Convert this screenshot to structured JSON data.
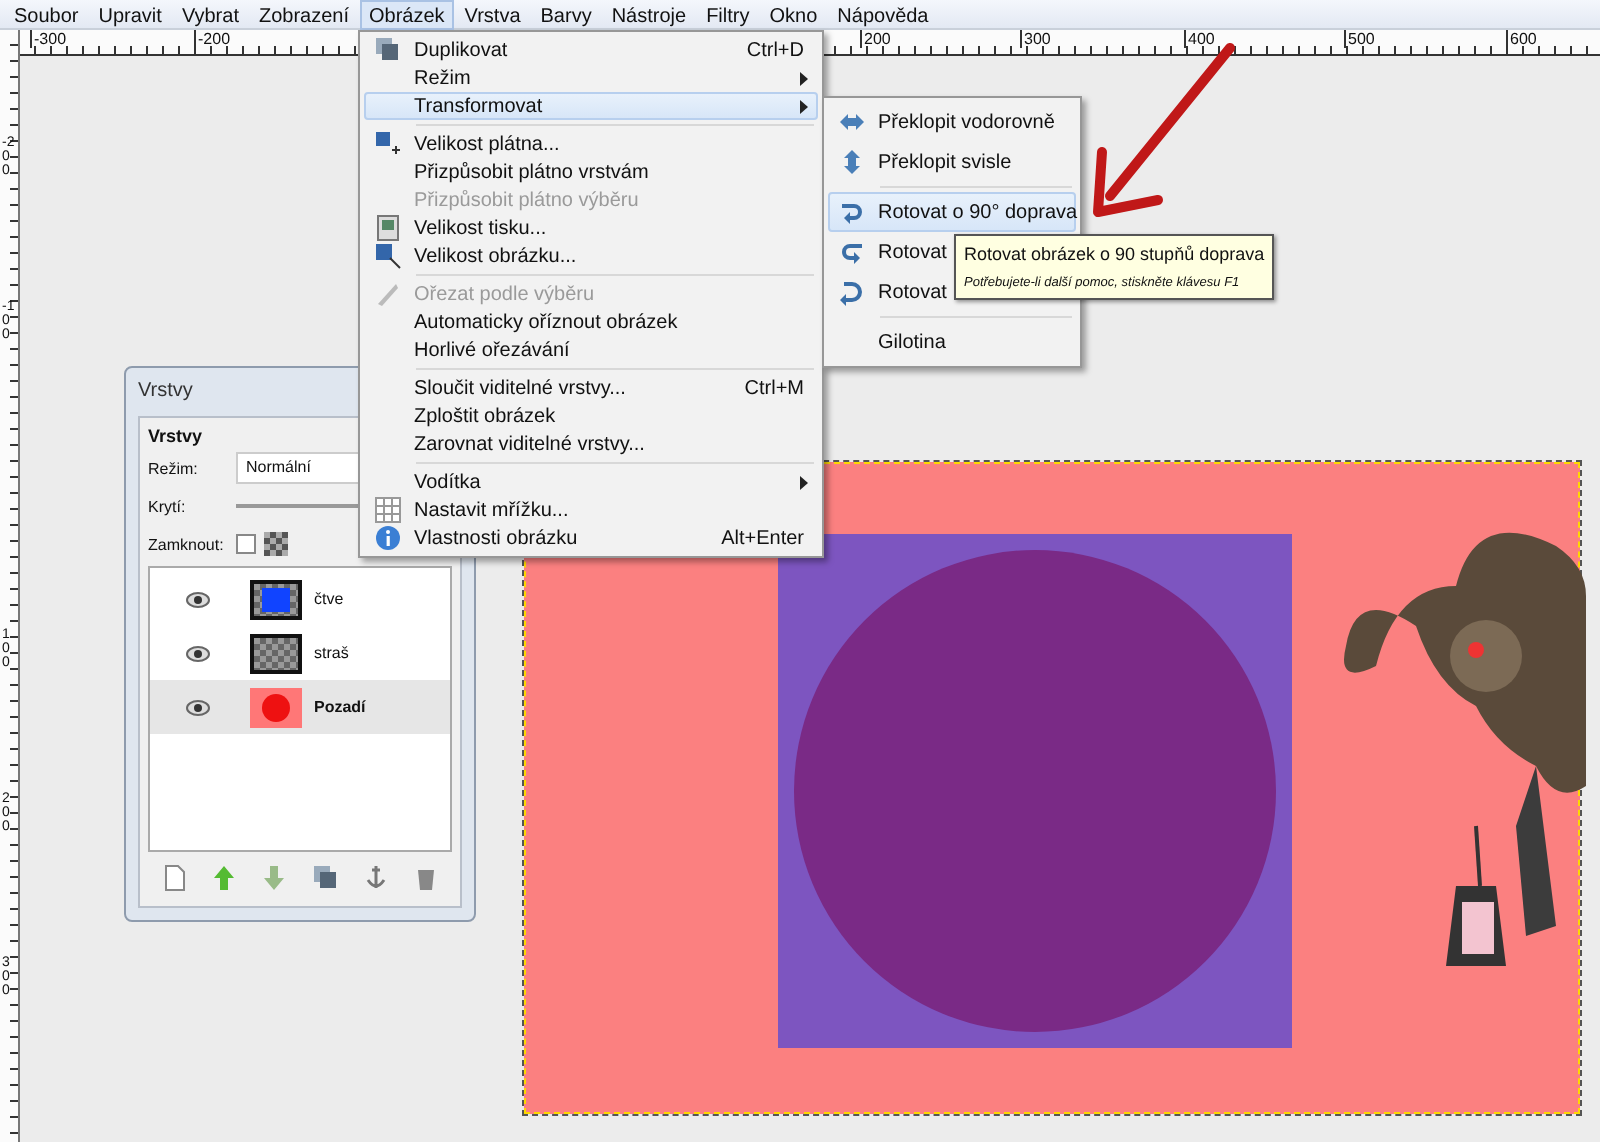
{
  "menubar": [
    {
      "label": "Soubor",
      "selected": false
    },
    {
      "label": "Upravit",
      "selected": false
    },
    {
      "label": "Vybrat",
      "selected": false
    },
    {
      "label": "Zobrazení",
      "selected": false
    },
    {
      "label": "Obrázek",
      "selected": true
    },
    {
      "label": "Vrstva",
      "selected": false
    },
    {
      "label": "Barvy",
      "selected": false
    },
    {
      "label": "Nástroje",
      "selected": false
    },
    {
      "label": "Filtry",
      "selected": false
    },
    {
      "label": "Okno",
      "selected": false
    },
    {
      "label": "Nápověda",
      "selected": false
    }
  ],
  "top_ruler": [
    "-300",
    "-200",
    "200",
    "300",
    "400",
    "500",
    "600"
  ],
  "left_ruler": [
    "-200",
    "-100",
    "100",
    "200",
    "300"
  ],
  "image_menu": [
    {
      "kind": "item",
      "label": "Duplikovat",
      "shortcut": "Ctrl+D",
      "submenu": false,
      "disabled": false,
      "selected": false
    },
    {
      "kind": "item",
      "label": "Režim",
      "submenu": true,
      "disabled": false,
      "selected": false
    },
    {
      "kind": "item",
      "label": "Transformovat",
      "submenu": true,
      "disabled": false,
      "selected": true
    },
    {
      "kind": "separator"
    },
    {
      "kind": "item",
      "label": "Velikost plátna...",
      "submenu": false,
      "disabled": false,
      "selected": false
    },
    {
      "kind": "item",
      "label": "Přizpůsobit plátno vrstvám",
      "submenu": false,
      "disabled": false,
      "selected": false
    },
    {
      "kind": "item",
      "label": "Přizpůsobit plátno výběru",
      "submenu": false,
      "disabled": true,
      "selected": false
    },
    {
      "kind": "item",
      "label": "Velikost tisku...",
      "submenu": false,
      "disabled": false,
      "selected": false
    },
    {
      "kind": "item",
      "label": "Velikost obrázku...",
      "submenu": false,
      "disabled": false,
      "selected": false
    },
    {
      "kind": "separator"
    },
    {
      "kind": "item",
      "label": "Ořezat podle výběru",
      "submenu": false,
      "disabled": true,
      "selected": false
    },
    {
      "kind": "item",
      "label": "Automaticky oříznout obrázek",
      "submenu": false,
      "disabled": false,
      "selected": false
    },
    {
      "kind": "item",
      "label": "Horlivé ořezávání",
      "submenu": false,
      "disabled": false,
      "selected": false
    },
    {
      "kind": "separator"
    },
    {
      "kind": "item",
      "label": "Sloučit viditelné vrstvy...",
      "shortcut": "Ctrl+M",
      "submenu": false,
      "disabled": false,
      "selected": false
    },
    {
      "kind": "item",
      "label": "Zploštit obrázek",
      "submenu": false,
      "disabled": false,
      "selected": false
    },
    {
      "kind": "item",
      "label": "Zarovnat viditelné vrstvy...",
      "submenu": false,
      "disabled": false,
      "selected": false
    },
    {
      "kind": "separator"
    },
    {
      "kind": "item",
      "label": "Vodítka",
      "submenu": true,
      "disabled": false,
      "selected": false
    },
    {
      "kind": "item",
      "label": "Nastavit mřížku...",
      "submenu": false,
      "disabled": false,
      "selected": false
    },
    {
      "kind": "item",
      "label": "Vlastnosti obrázku",
      "shortcut": "Alt+Enter",
      "submenu": false,
      "disabled": false,
      "selected": false
    }
  ],
  "transform_menu": [
    {
      "kind": "item",
      "label": "Překlopit vodorovně",
      "selected": false
    },
    {
      "kind": "item",
      "label": "Překlopit svisle",
      "selected": false
    },
    {
      "kind": "separator"
    },
    {
      "kind": "item",
      "label": "Rotovat o 90° doprava",
      "selected": true
    },
    {
      "kind": "item",
      "label": "Rotovat",
      "selected": false
    },
    {
      "kind": "item",
      "label": "Rotovat",
      "selected": false
    },
    {
      "kind": "separator"
    },
    {
      "kind": "item",
      "label": "Gilotina",
      "selected": false
    }
  ],
  "tooltip": {
    "title": "Rotovat obrázek o 90 stupňů doprava",
    "hint": "Potřebujete-li další pomoc, stiskněte klávesu F1"
  },
  "layers_window": {
    "title": "Vrstvy",
    "heading": "Vrstvy",
    "mode_label": "Režim:",
    "mode_value": "Normální",
    "opacity": {
      "label": "Krytí:",
      "level": 1
    },
    "lock_label": "Zamknout:",
    "lock_pixels": false,
    "layers": [
      {
        "name": "čtve",
        "kind": "blue-square",
        "visible": true,
        "selected": false
      },
      {
        "name": "straš",
        "kind": "transparent",
        "visible": true,
        "selected": false
      },
      {
        "name": "Pozadí",
        "kind": "red-circle",
        "visible": true,
        "selected": true
      }
    ]
  }
}
